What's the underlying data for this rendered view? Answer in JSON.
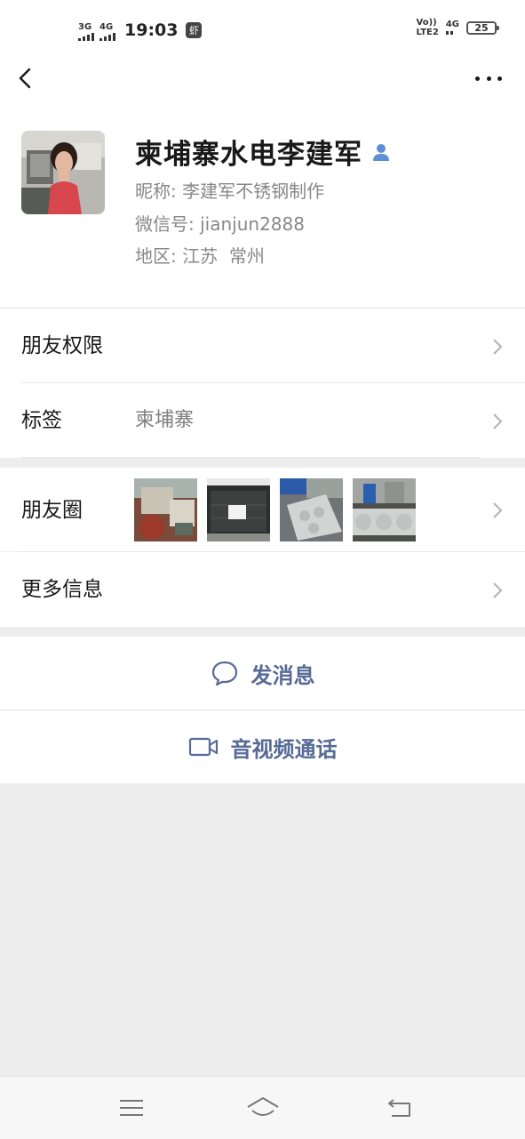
{
  "status_bar": {
    "sim1_network": "3G",
    "sim2_network": "4G",
    "time": "19:03",
    "app_icon_glyph": "虾",
    "volte_line1": "Vo))",
    "volte_line2": "LTE2",
    "network_right": "4G",
    "battery_level": "25"
  },
  "profile": {
    "display_name": "柬埔寨水电李建军",
    "nickname_label": "昵称:",
    "nickname": "李建军不锈钢制作",
    "wechat_id_label": "微信号:",
    "wechat_id": "jianjun2888",
    "region_label": "地区:",
    "region": "江苏  常州"
  },
  "rows": {
    "friend_permissions": "朋友权限",
    "tags_label": "标签",
    "tags_value": "柬埔寨",
    "moments": "朋友圈",
    "more_info": "更多信息"
  },
  "actions": {
    "send_message": "发消息",
    "av_call": "音视频通话"
  },
  "colors": {
    "link": "#576b95",
    "background": "#ededed"
  }
}
